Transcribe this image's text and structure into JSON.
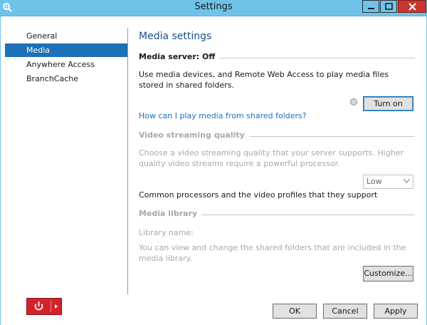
{
  "window": {
    "title": "Settings",
    "controls": {
      "minimize": "minimize",
      "maximize": "maximize",
      "close": "close"
    }
  },
  "sidebar": {
    "items": [
      {
        "label": "General",
        "active": false
      },
      {
        "label": "Media",
        "active": true
      },
      {
        "label": "Anywhere Access",
        "active": false
      },
      {
        "label": "BranchCache",
        "active": false
      }
    ]
  },
  "main": {
    "title": "Media settings",
    "media_server": {
      "label": "Media server: Off",
      "description": "Use media devices, and Remote Web Access to play media files stored in shared folders.",
      "turn_on_label": "Turn on",
      "help_link": "How can I play media from shared folders?"
    },
    "video": {
      "label": "Video streaming quality",
      "description": "Choose a video streaming quality that your server supports. Higher quality video streams require a powerful processor.",
      "quality_selected": "Low",
      "processors_text": "Common processors and the video profiles that they support"
    },
    "library": {
      "label": "Media library",
      "name_label": "Library name:",
      "description": "You can view and change the shared folders that are included in the media library.",
      "customize_label": "Customize..."
    }
  },
  "footer": {
    "ok_label": "OK",
    "cancel_label": "Cancel",
    "apply_label": "Apply"
  },
  "colors": {
    "titlebar": "#6fc3e8",
    "accent": "#1e70b7",
    "close": "#c7372f",
    "power": "#d2232a"
  },
  "icons": {
    "app": "settings-gear-icon",
    "power": "power-icon",
    "arrow": "caret-right-icon"
  }
}
